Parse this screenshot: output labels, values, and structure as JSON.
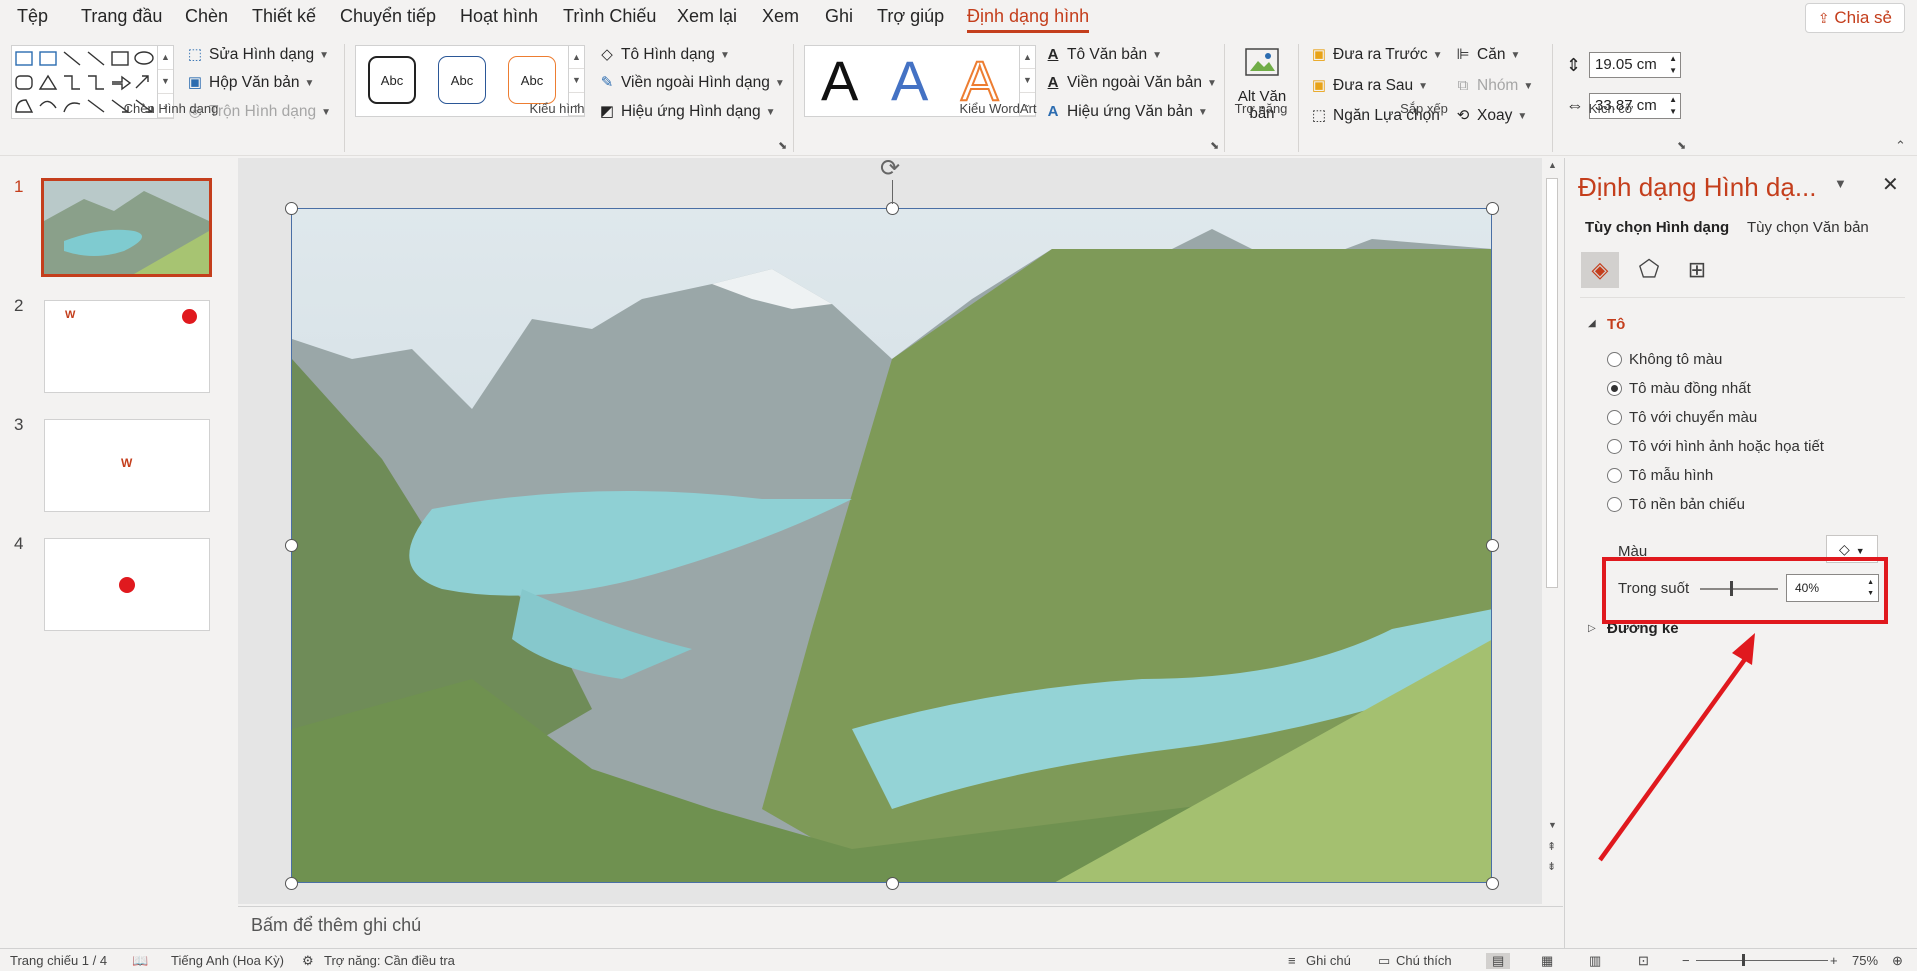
{
  "tabs": [
    "Tệp",
    "Trang đầu",
    "Chèn",
    "Thiết kế",
    "Chuyển tiếp",
    "Hoạt hình",
    "Trình Chiếu",
    "Xem lại",
    "Xem",
    "Ghi",
    "Trợ giúp",
    "Định dạng hình"
  ],
  "share_label": "Chia sẻ",
  "ribbon": {
    "insert_shapes": {
      "group": "Chèn Hình dạng",
      "edit_shape": "Sửa Hình dạng",
      "text_box": "Hộp Văn bản",
      "merge_shapes": "Trộn Hình dạng"
    },
    "shape_styles": {
      "group": "Kiểu hình",
      "style_samples": [
        "Abc",
        "Abc",
        "Abc"
      ],
      "shape_fill": "Tô Hình dạng",
      "shape_outline": "Viền ngoài Hình dạng",
      "shape_effects": "Hiệu ứng Hình dạng"
    },
    "wordart": {
      "group": "Kiểu WordArt",
      "letters": [
        "A",
        "A",
        "A"
      ],
      "text_fill": "Tô Văn bản",
      "text_outline": "Viền ngoài Văn bản",
      "text_effects": "Hiệu ứng Văn bản"
    },
    "accessibility": {
      "group": "Trợ năng",
      "alt_text_line1": "Alt Văn",
      "alt_text_line2": "bản"
    },
    "arrange": {
      "group": "Sắp xếp",
      "bring_forward": "Đưa ra Trước",
      "send_backward": "Đưa ra Sau",
      "selection_pane": "Ngăn Lựa chọn",
      "align": "Căn",
      "group_btn": "Nhóm",
      "rotate": "Xoay"
    },
    "size": {
      "group": "Kích cỡ",
      "height": "19.05 cm",
      "width": "33.87 cm"
    }
  },
  "slides": [
    {
      "num": "1"
    },
    {
      "num": "2"
    },
    {
      "num": "3"
    },
    {
      "num": "4"
    }
  ],
  "notes_placeholder": "Bấm để thêm ghi chú",
  "pane": {
    "title": "Định dạng Hình dạ...",
    "tab_shape": "Tùy chọn Hình dạng",
    "tab_text": "Tùy chọn Văn bản",
    "fill_section": "Tô",
    "fill_options": [
      "Không tô màu",
      "Tô màu đồng nhất",
      "Tô với chuyển màu",
      "Tô với hình ảnh hoặc họa tiết",
      "Tô mẫu hình",
      "Tô nền bản chiếu"
    ],
    "selected_fill": 1,
    "color_label": "Màu",
    "transparency_label": "Trong suốt",
    "transparency_value": "40%",
    "line_section": "Đường kẻ"
  },
  "status": {
    "slide": "Trang chiếu 1 / 4",
    "language": "Tiếng Anh (Hoa Kỳ)",
    "accessibility": "Trợ năng: Cần điều tra",
    "notes": "Ghi chú",
    "comments": "Chú thích",
    "zoom": "75%"
  },
  "colors": {
    "accent": "#c43e1c",
    "highlight_box": "#e0191e",
    "arrow": "#e0191e"
  }
}
